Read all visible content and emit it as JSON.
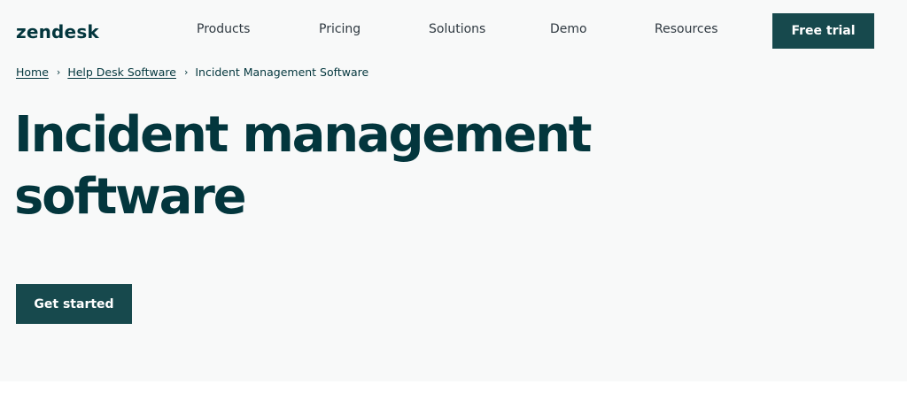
{
  "header": {
    "logo": "zendesk",
    "nav": [
      {
        "label": "Products"
      },
      {
        "label": "Pricing"
      },
      {
        "label": "Solutions"
      },
      {
        "label": "Demo"
      },
      {
        "label": "Resources"
      }
    ],
    "cta_label": "Free trial"
  },
  "breadcrumb": {
    "items": [
      {
        "label": "Home"
      },
      {
        "label": "Help Desk Software"
      },
      {
        "label": "Incident Management Software"
      }
    ],
    "separator": "›"
  },
  "hero": {
    "title_line1": "Incident management",
    "title_line2": "software",
    "cta_label": "Get started"
  },
  "colors": {
    "brand_dark": "#03363d",
    "button_bg": "#17494d",
    "hero_bg": "#f8f9f9"
  }
}
